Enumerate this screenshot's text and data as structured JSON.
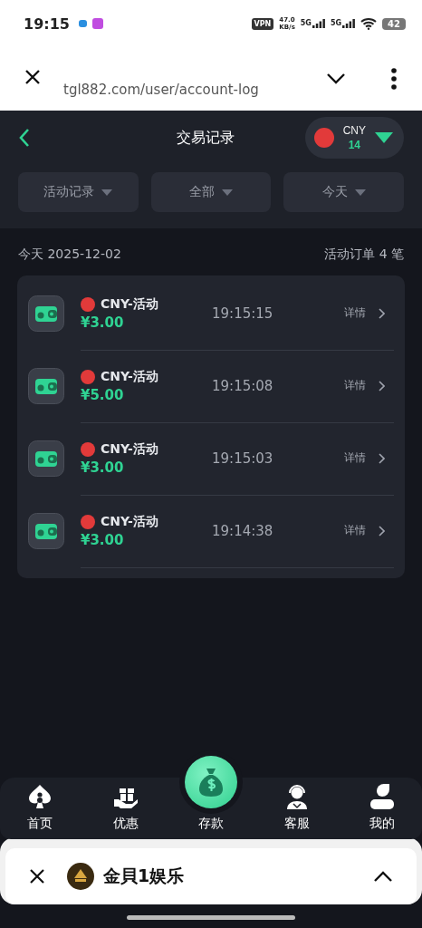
{
  "status_bar": {
    "time": "19:15",
    "vpn": "VPN",
    "speed_value": "47.0",
    "speed_unit": "KB/s",
    "networks": [
      "5G",
      "5G"
    ],
    "battery": "42"
  },
  "browser": {
    "url": "tgl882.com/user/account-log"
  },
  "header": {
    "title": "交易记录",
    "currency": "CNY",
    "balance": "14"
  },
  "filters": [
    {
      "label": "活动记录"
    },
    {
      "label": "全部"
    },
    {
      "label": "今天"
    }
  ],
  "summary": {
    "date": "今天 2025-12-02",
    "count": "活动订单 4 笔"
  },
  "records": [
    {
      "name": "CNY-活动",
      "amount": "¥3.00",
      "time": "19:15:15",
      "action": "详情"
    },
    {
      "name": "CNY-活动",
      "amount": "¥5.00",
      "time": "19:15:08",
      "action": "详情"
    },
    {
      "name": "CNY-活动",
      "amount": "¥3.00",
      "time": "19:15:03",
      "action": "详情"
    },
    {
      "name": "CNY-活动",
      "amount": "¥3.00",
      "time": "19:14:38",
      "action": "详情"
    }
  ],
  "nav": [
    {
      "label": "首页",
      "kind": "home"
    },
    {
      "label": "优惠",
      "kind": "gift"
    },
    {
      "label": "存款",
      "kind": "deposit"
    },
    {
      "label": "客服",
      "kind": "support"
    },
    {
      "label": "我的",
      "kind": "user"
    }
  ],
  "app_sheet": {
    "title": "金貝1娱乐"
  }
}
